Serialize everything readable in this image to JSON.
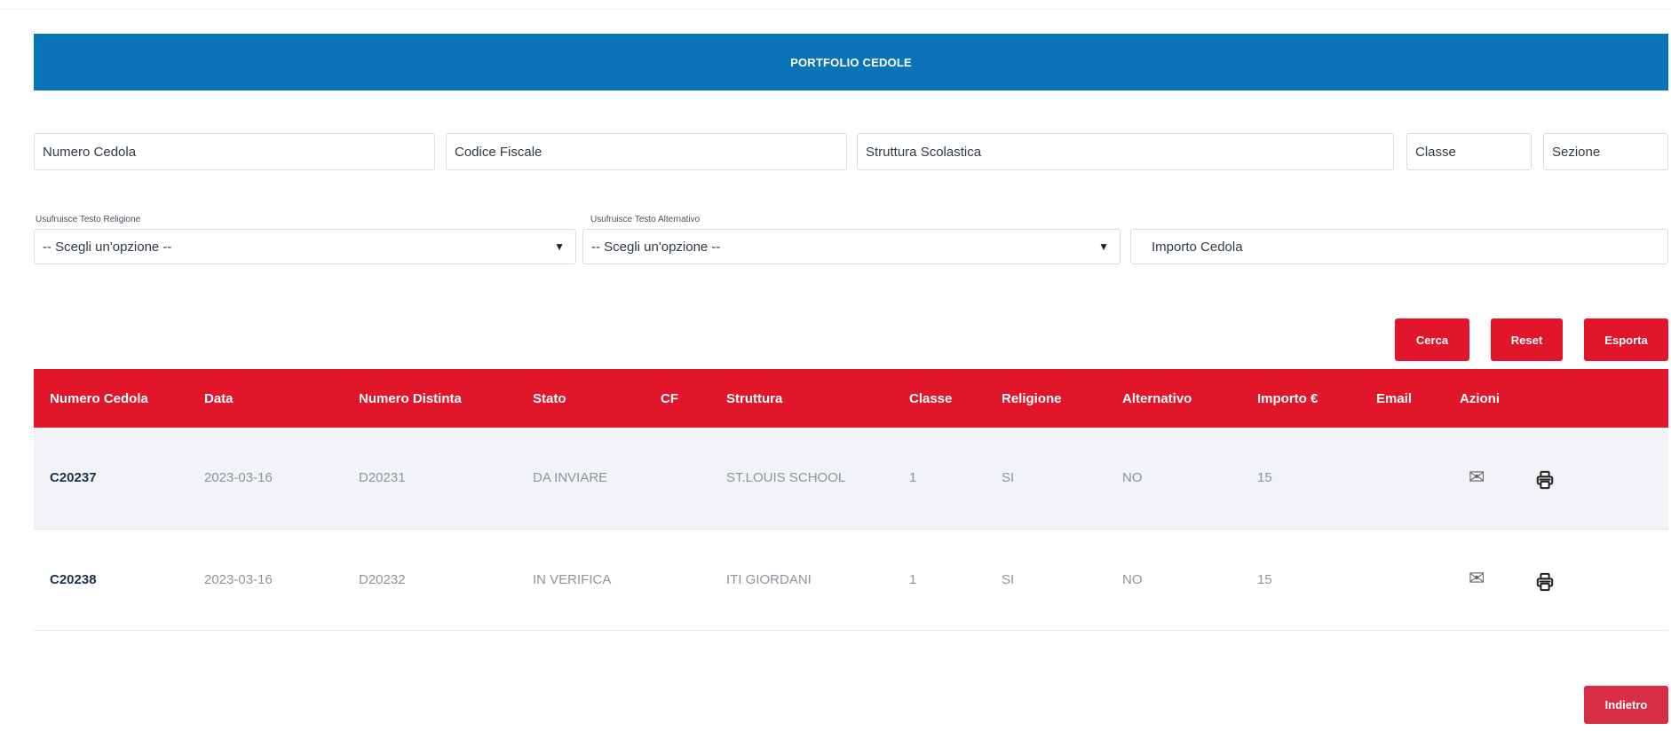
{
  "header": {
    "title": "PORTFOLIO CEDOLE"
  },
  "filters": {
    "numero_cedola": "Numero Cedola",
    "codice_fiscale": "Codice Fiscale",
    "struttura_scolastica": "Struttura Scolastica",
    "classe": "Classe",
    "sezione": "Sezione",
    "religione_label": "Usufruisce Testo Religione",
    "religione_value": "-- Scegli un'opzione --",
    "alternativo_label": "Usufruisce Testo Alternativo",
    "alternativo_value": "-- Scegli un'opzione --",
    "importo_cedola": "Importo Cedola"
  },
  "actions": {
    "cerca": "Cerca",
    "reset": "Reset",
    "esporta": "Esporta",
    "indietro": "Indietro"
  },
  "table": {
    "columns": [
      "Numero Cedola",
      "Data",
      "Numero Distinta",
      "Stato",
      "CF",
      "Struttura",
      "Classe",
      "Religione",
      "Alternativo",
      "Importo €",
      "Email",
      "Azioni"
    ],
    "rows": [
      {
        "numero": "C20237",
        "data": "2023-03-16",
        "distinta": "D20231",
        "stato": "DA INVIARE",
        "cf": "",
        "struttura": "ST.LOUIS SCHOOL",
        "classe": "1",
        "religione": "SI",
        "alternativo": "NO",
        "importo": "15",
        "email": ""
      },
      {
        "numero": "C20238",
        "data": "2023-03-16",
        "distinta": "D20232",
        "stato": "IN VERIFICA",
        "cf": "",
        "struttura": "ITI GIORDANI",
        "classe": "1",
        "religione": "SI",
        "alternativo": "NO",
        "importo": "15",
        "email": ""
      }
    ]
  },
  "colors": {
    "banner": "#0b73b8",
    "accent": "#e2162b",
    "row_shade": "#f1f3f6"
  },
  "icons": {
    "mail": "envelope-icon",
    "print": "printer-icon",
    "caret": "caret-down-icon"
  }
}
